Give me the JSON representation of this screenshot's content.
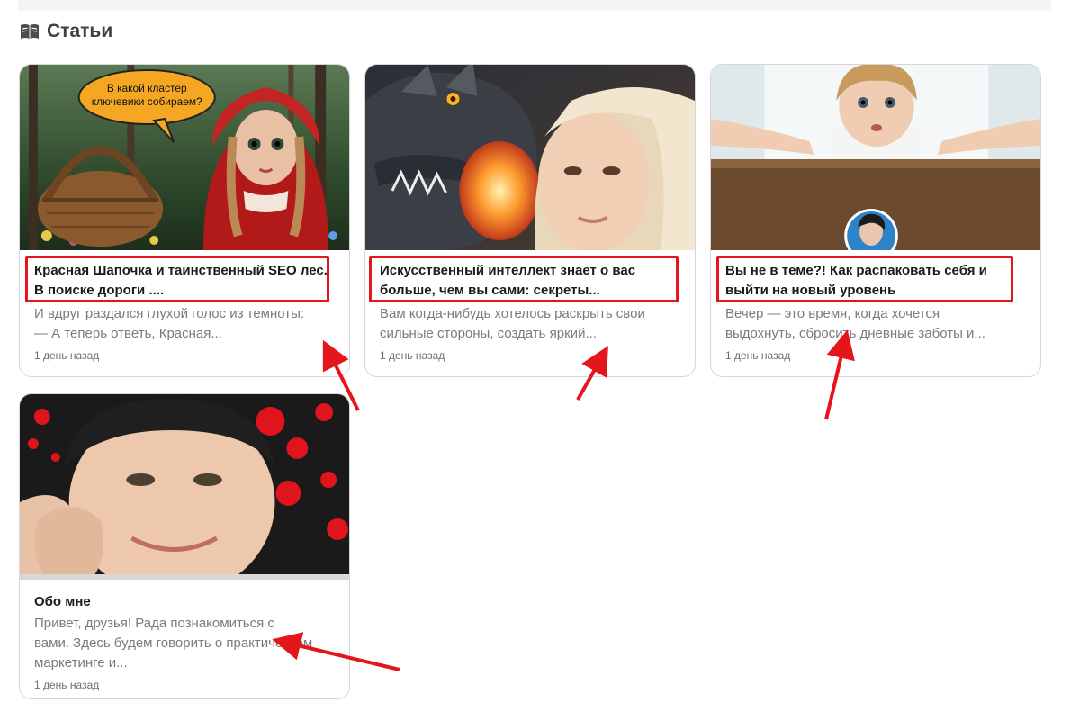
{
  "section": {
    "title": "Статьи",
    "icon": "book-icon"
  },
  "cover_art": {
    "speech_bubble": "В какой кластер ключевики собираем?"
  },
  "articles": [
    {
      "title": "Красная Шапочка и таинственный SEO лес. В поиске дороги ....",
      "excerpt": "И вдруг раздался глухой голос из темноты: — А теперь ответь, Красная...",
      "date": "1 день назад"
    },
    {
      "title": "Искусственный интеллект знает о вас больше, чем вы сами: секреты...",
      "excerpt": "Вам когда-нибудь хотелось раскрыть свои сильные стороны, создать яркий...",
      "date": "1 день назад"
    },
    {
      "title": "Вы не в теме?! Как распаковать себя и выйти на новый уровень",
      "excerpt": "Вечер — это время, когда хочется выдохнуть, сбросить дневные заботы и...",
      "date": "1 день назад"
    },
    {
      "title": "Обо мне",
      "excerpt": "Привет, друзья! Рада познакомиться с вами. Здесь будем говорить о практическом маркетинге и...",
      "date": "1 день назад"
    }
  ],
  "colors": {
    "highlight": "#e4161c",
    "card_border": "#d6d6d9",
    "excerpt_text": "#7a7a80"
  }
}
